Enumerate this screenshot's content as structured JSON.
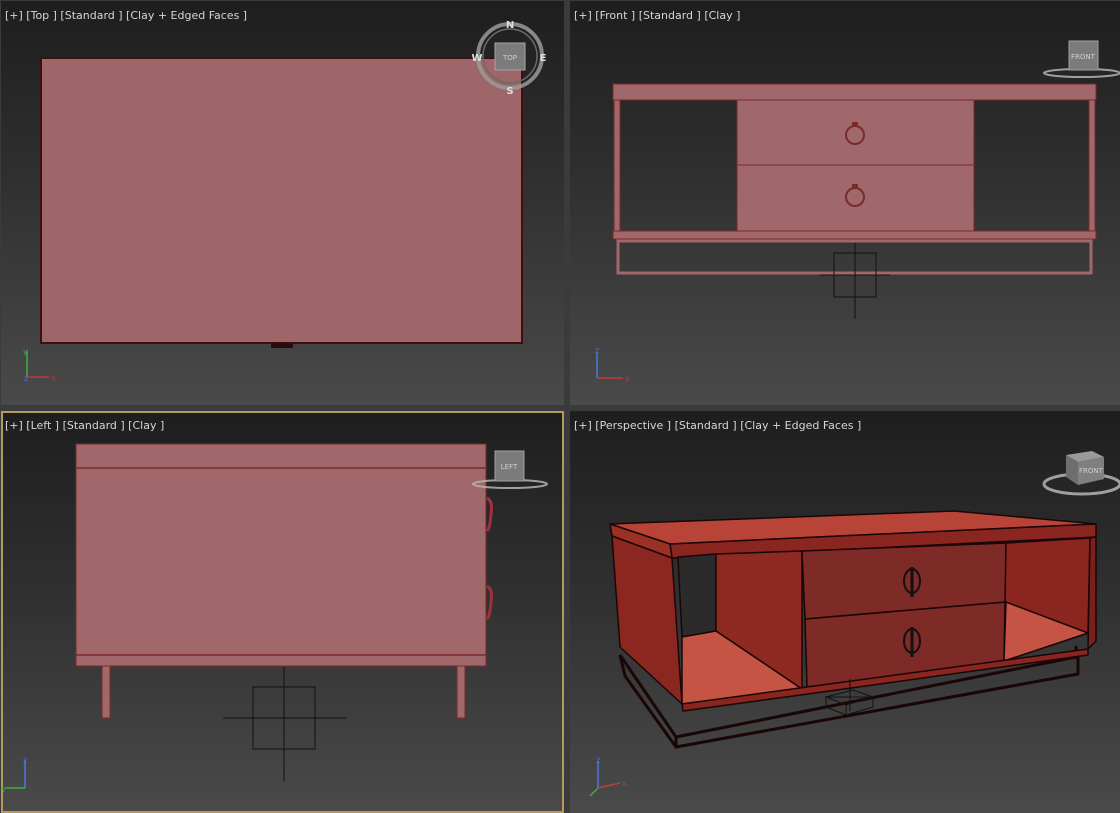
{
  "viewports": {
    "top": {
      "label": "[+] [Top ] [Standard ] [Clay + Edged Faces ]",
      "viewcube_label": "TOP",
      "compass": {
        "n": "N",
        "s": "S",
        "e": "E",
        "w": "W"
      },
      "axes": {
        "a": "y",
        "b": "z",
        "c": "x"
      }
    },
    "front": {
      "label": "[+] [Front ] [Standard ] [Clay ]",
      "viewcube_label": "FRONT",
      "axes": {
        "a": "z",
        "b": "x"
      }
    },
    "left": {
      "label": "[+] [Left ] [Standard ] [Clay ]",
      "viewcube_label": "LEFT",
      "axes": {
        "a": "z",
        "b": "y"
      }
    },
    "perspective": {
      "label": "[+] [Perspective ] [Standard ] [Clay + Edged Faces ]",
      "viewcube_label": "FRONT",
      "axes": {
        "a": "z",
        "b": "x"
      }
    }
  },
  "colors": {
    "clay": "#a0686a",
    "clay_edge": "#7a2a2a",
    "perspective_red": "#8a2520",
    "active_border": "#b59a5b"
  }
}
